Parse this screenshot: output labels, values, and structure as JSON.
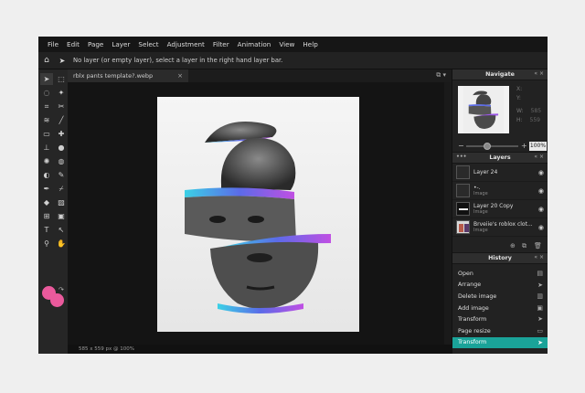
{
  "menu": [
    "File",
    "Edit",
    "Page",
    "Layer",
    "Select",
    "Adjustment",
    "Filter",
    "Animation",
    "View",
    "Help"
  ],
  "options_bar": {
    "message": "No layer (or empty layer), select a layer in the right hand layer bar.",
    "home_icon": "home-icon",
    "tool_icon": "arrow-cursor-icon"
  },
  "document": {
    "tab_title": "rblx pants template?.webp",
    "status": "585 x 559 px @ 100%"
  },
  "colors": {
    "foreground": "#ea5a9c",
    "background": "#ea5a9c",
    "accent": "#1aa399"
  },
  "navigate": {
    "title": "Navigate",
    "x_label": "X:",
    "y_label": "Y:",
    "w_label": "W:",
    "w_value": "585",
    "h_label": "H:",
    "h_value": "559",
    "zoom": "100%"
  },
  "layers": {
    "title": "Layers",
    "items": [
      {
        "name": "Layer 24",
        "type": "",
        "thumb": "empty"
      },
      {
        "name": "•-.",
        "type": "Image",
        "thumb": "empty"
      },
      {
        "name": "Layer 20 Copy",
        "type": "Image",
        "thumb": "dark"
      },
      {
        "name": "Brveiie's roblox clot...",
        "type": "Image",
        "thumb": "photo"
      }
    ]
  },
  "history": {
    "title": "History",
    "items": [
      {
        "label": "Open",
        "icon": "file-icon"
      },
      {
        "label": "Arrange",
        "icon": "arrow-cursor-icon"
      },
      {
        "label": "Delete image",
        "icon": "trash-icon"
      },
      {
        "label": "Add image",
        "icon": "image-icon"
      },
      {
        "label": "Transform",
        "icon": "arrow-cursor-icon"
      },
      {
        "label": "Page resize",
        "icon": "page-icon"
      },
      {
        "label": "Transform",
        "icon": "arrow-cursor-icon",
        "active": true
      }
    ]
  }
}
